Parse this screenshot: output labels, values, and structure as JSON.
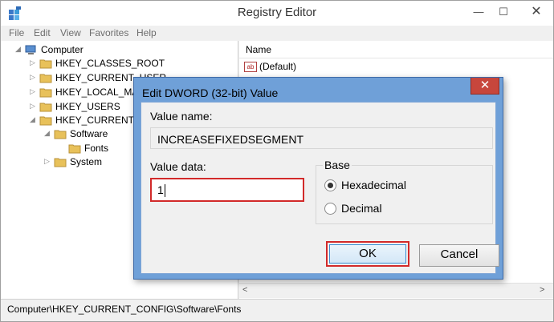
{
  "window": {
    "title": "Registry Editor",
    "minimize_glyph": "—",
    "maximize_glyph": "☐",
    "close_glyph": "✕"
  },
  "menu": [
    "File",
    "Edit",
    "View",
    "Favorites",
    "Help"
  ],
  "tree": {
    "root": "Computer",
    "items": [
      "HKEY_CLASSES_ROOT",
      "HKEY_CURRENT_USER",
      "HKEY_LOCAL_MAC",
      "HKEY_USERS",
      "HKEY_CURRENT_CO",
      "Software",
      "Fonts",
      "System"
    ]
  },
  "list": {
    "column_name": "Name",
    "default_icon_text": "ab",
    "default_value": "(Default)",
    "scroll_left_glyph": "<",
    "scroll_right_glyph": ">"
  },
  "status": {
    "path": "Computer\\HKEY_CURRENT_CONFIG\\Software\\Fonts"
  },
  "dialog": {
    "title": "Edit DWORD (32-bit) Value",
    "close_glyph": "✕",
    "value_name_label": "Value name:",
    "value_name": "INCREASEFIXEDSEGMENT",
    "value_data_label": "Value data:",
    "value_data": "1",
    "base_label": "Base",
    "base_options": [
      "Hexadecimal",
      "Decimal"
    ],
    "base_selected": "Hexadecimal",
    "ok_label": "OK",
    "cancel_label": "Cancel"
  },
  "colors": {
    "dialog_frame": "#6fa0d8",
    "close_red": "#c7463c",
    "highlight_red": "#d22a2a",
    "folder_yellow": "#e8c15a"
  }
}
